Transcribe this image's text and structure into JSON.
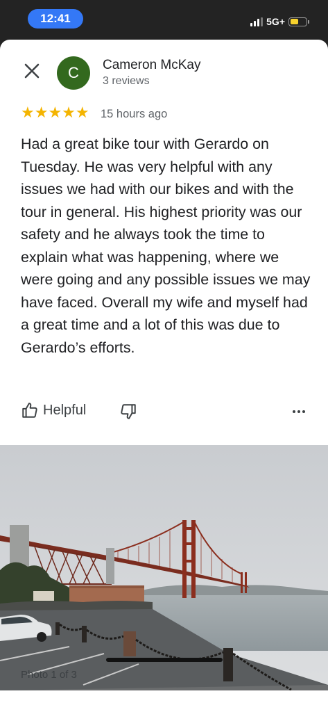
{
  "status_bar": {
    "time": "12:41",
    "network": "5G+",
    "signal_bars": 3,
    "battery_level": 0.35,
    "battery_color": "#f7d22d",
    "time_pill_color": "#3478f6"
  },
  "review": {
    "close_icon": "close-icon",
    "avatar_letter": "C",
    "avatar_color": "#33691e",
    "reviewer_name": "Cameron McKay",
    "review_count": "3 reviews",
    "stars": "★★★★★",
    "rating": 5,
    "rating_max": 5,
    "star_color": "#f4b400",
    "time_ago": "15 hours ago",
    "text": "Had a great bike tour with Gerardo on Tuesday.  He was very helpful with any issues we had with our bikes and with the tour in general.  His highest priority was our safety and he always took the time to explain what was happening, where we were going and any possible issues we may have faced.  Overall my wife and myself had a great time and a lot of this was due to Gerardo’s efforts."
  },
  "actions": {
    "helpful_label": "Helpful",
    "helpful_icon": "thumbs-up-icon",
    "dislike_icon": "thumbs-down-icon",
    "more_icon": "more-horizontal-icon"
  },
  "photo": {
    "caption": "Photo 1 of 3"
  }
}
